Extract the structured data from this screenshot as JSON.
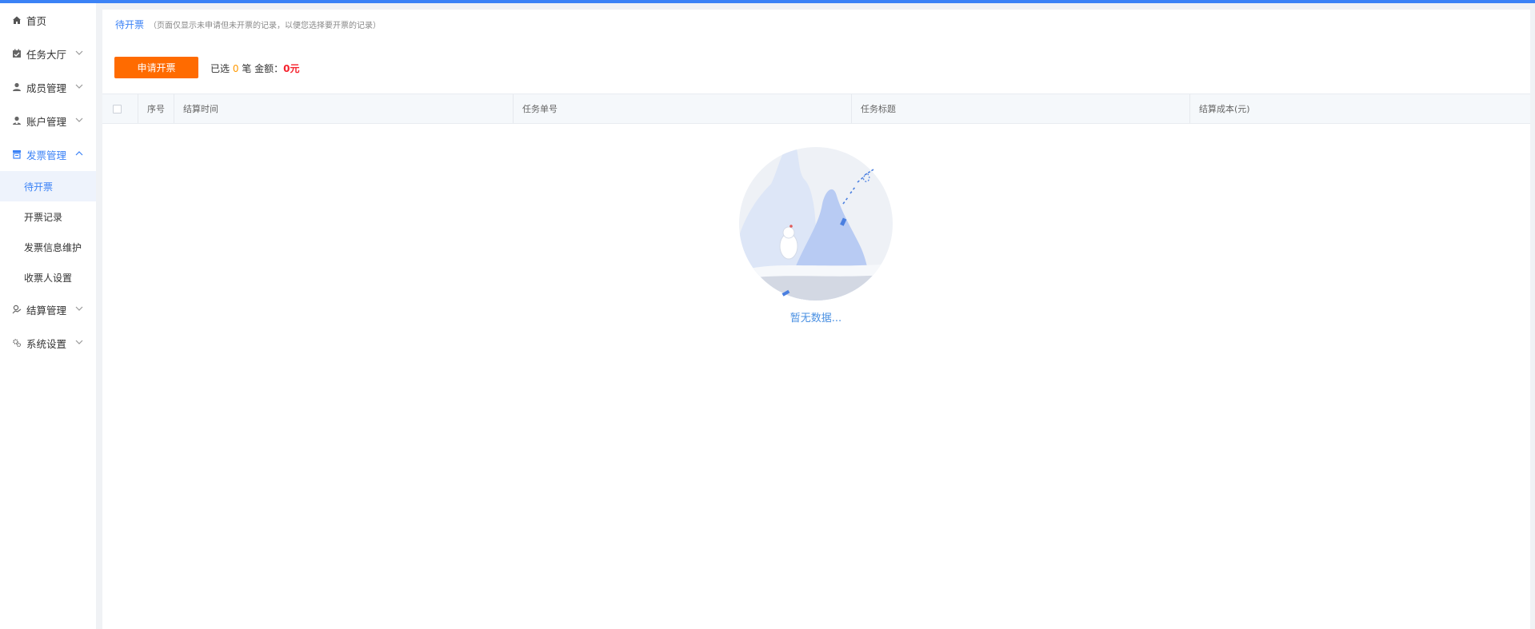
{
  "sidebar": {
    "items": [
      {
        "label": "首页",
        "icon": "home-icon"
      },
      {
        "label": "任务大厅",
        "icon": "task-icon"
      },
      {
        "label": "成员管理",
        "icon": "member-icon"
      },
      {
        "label": "账户管理",
        "icon": "account-icon"
      },
      {
        "label": "发票管理",
        "icon": "invoice-icon",
        "open": true,
        "children": [
          {
            "label": "待开票",
            "active": true
          },
          {
            "label": "开票记录"
          },
          {
            "label": "发票信息维护"
          },
          {
            "label": "收票人设置"
          }
        ]
      },
      {
        "label": "结算管理",
        "icon": "settlement-icon"
      },
      {
        "label": "系统设置",
        "icon": "settings-icon"
      }
    ]
  },
  "header": {
    "title": "待开票",
    "note": "（页面仅显示未申请但未开票的记录，以便您选择要开票的记录）"
  },
  "toolbar": {
    "apply_label": "申请开票",
    "selected_prefix": "已选",
    "selected_count": "0",
    "selected_unit": "笔 金额：",
    "amount": "0元"
  },
  "table": {
    "columns": [
      "序号",
      "结算时间",
      "任务单号",
      "任务标题",
      "结算成本(元)"
    ],
    "rows": []
  },
  "empty": {
    "text": "暂无数据..."
  },
  "colors": {
    "accent": "#3b82f6",
    "button": "#ff6b00",
    "amount": "#f5222d",
    "count": "#ff9900"
  }
}
